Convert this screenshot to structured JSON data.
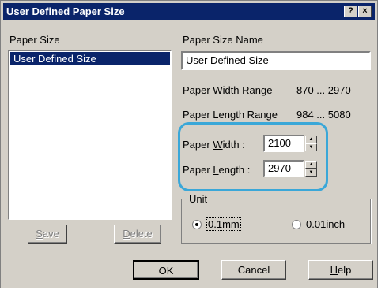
{
  "window": {
    "title": "User Defined Paper Size",
    "help_btn": "?",
    "close_btn": "×"
  },
  "paper_size": {
    "label": "Paper Size",
    "items": [
      "User Defined Size"
    ],
    "selected": "User Defined Size"
  },
  "paper_name": {
    "label": "Paper Size Name",
    "value": "User Defined Size"
  },
  "ranges": {
    "width_label": "Paper Width Range",
    "width_value": "870 ... 2970",
    "length_label": "Paper Length Range",
    "length_value": "984 ... 5080"
  },
  "width_field": {
    "label_pre": "Paper ",
    "label_accel": "W",
    "label_post": "idth  :",
    "value": "2100"
  },
  "length_field": {
    "label_pre": "Paper ",
    "label_accel": "L",
    "label_post": "ength :",
    "value": "2970"
  },
  "unit": {
    "label": "Unit",
    "option1_pre": "0.1",
    "option1_accel": "mm",
    "option2_pre": "0.01",
    "option2_accel": "i",
    "option2_post": "nch",
    "selected": "0.1mm"
  },
  "buttons": {
    "save_accel": "S",
    "save_rest": "ave",
    "delete_accel": "D",
    "delete_rest": "elete",
    "ok": "OK",
    "cancel": "Cancel",
    "help_accel": "H",
    "help_rest": "elp"
  },
  "colors": {
    "titlebar": "#0a246a",
    "highlight_ring": "#3aa7d8",
    "dialog_face": "#d4d0c8"
  }
}
